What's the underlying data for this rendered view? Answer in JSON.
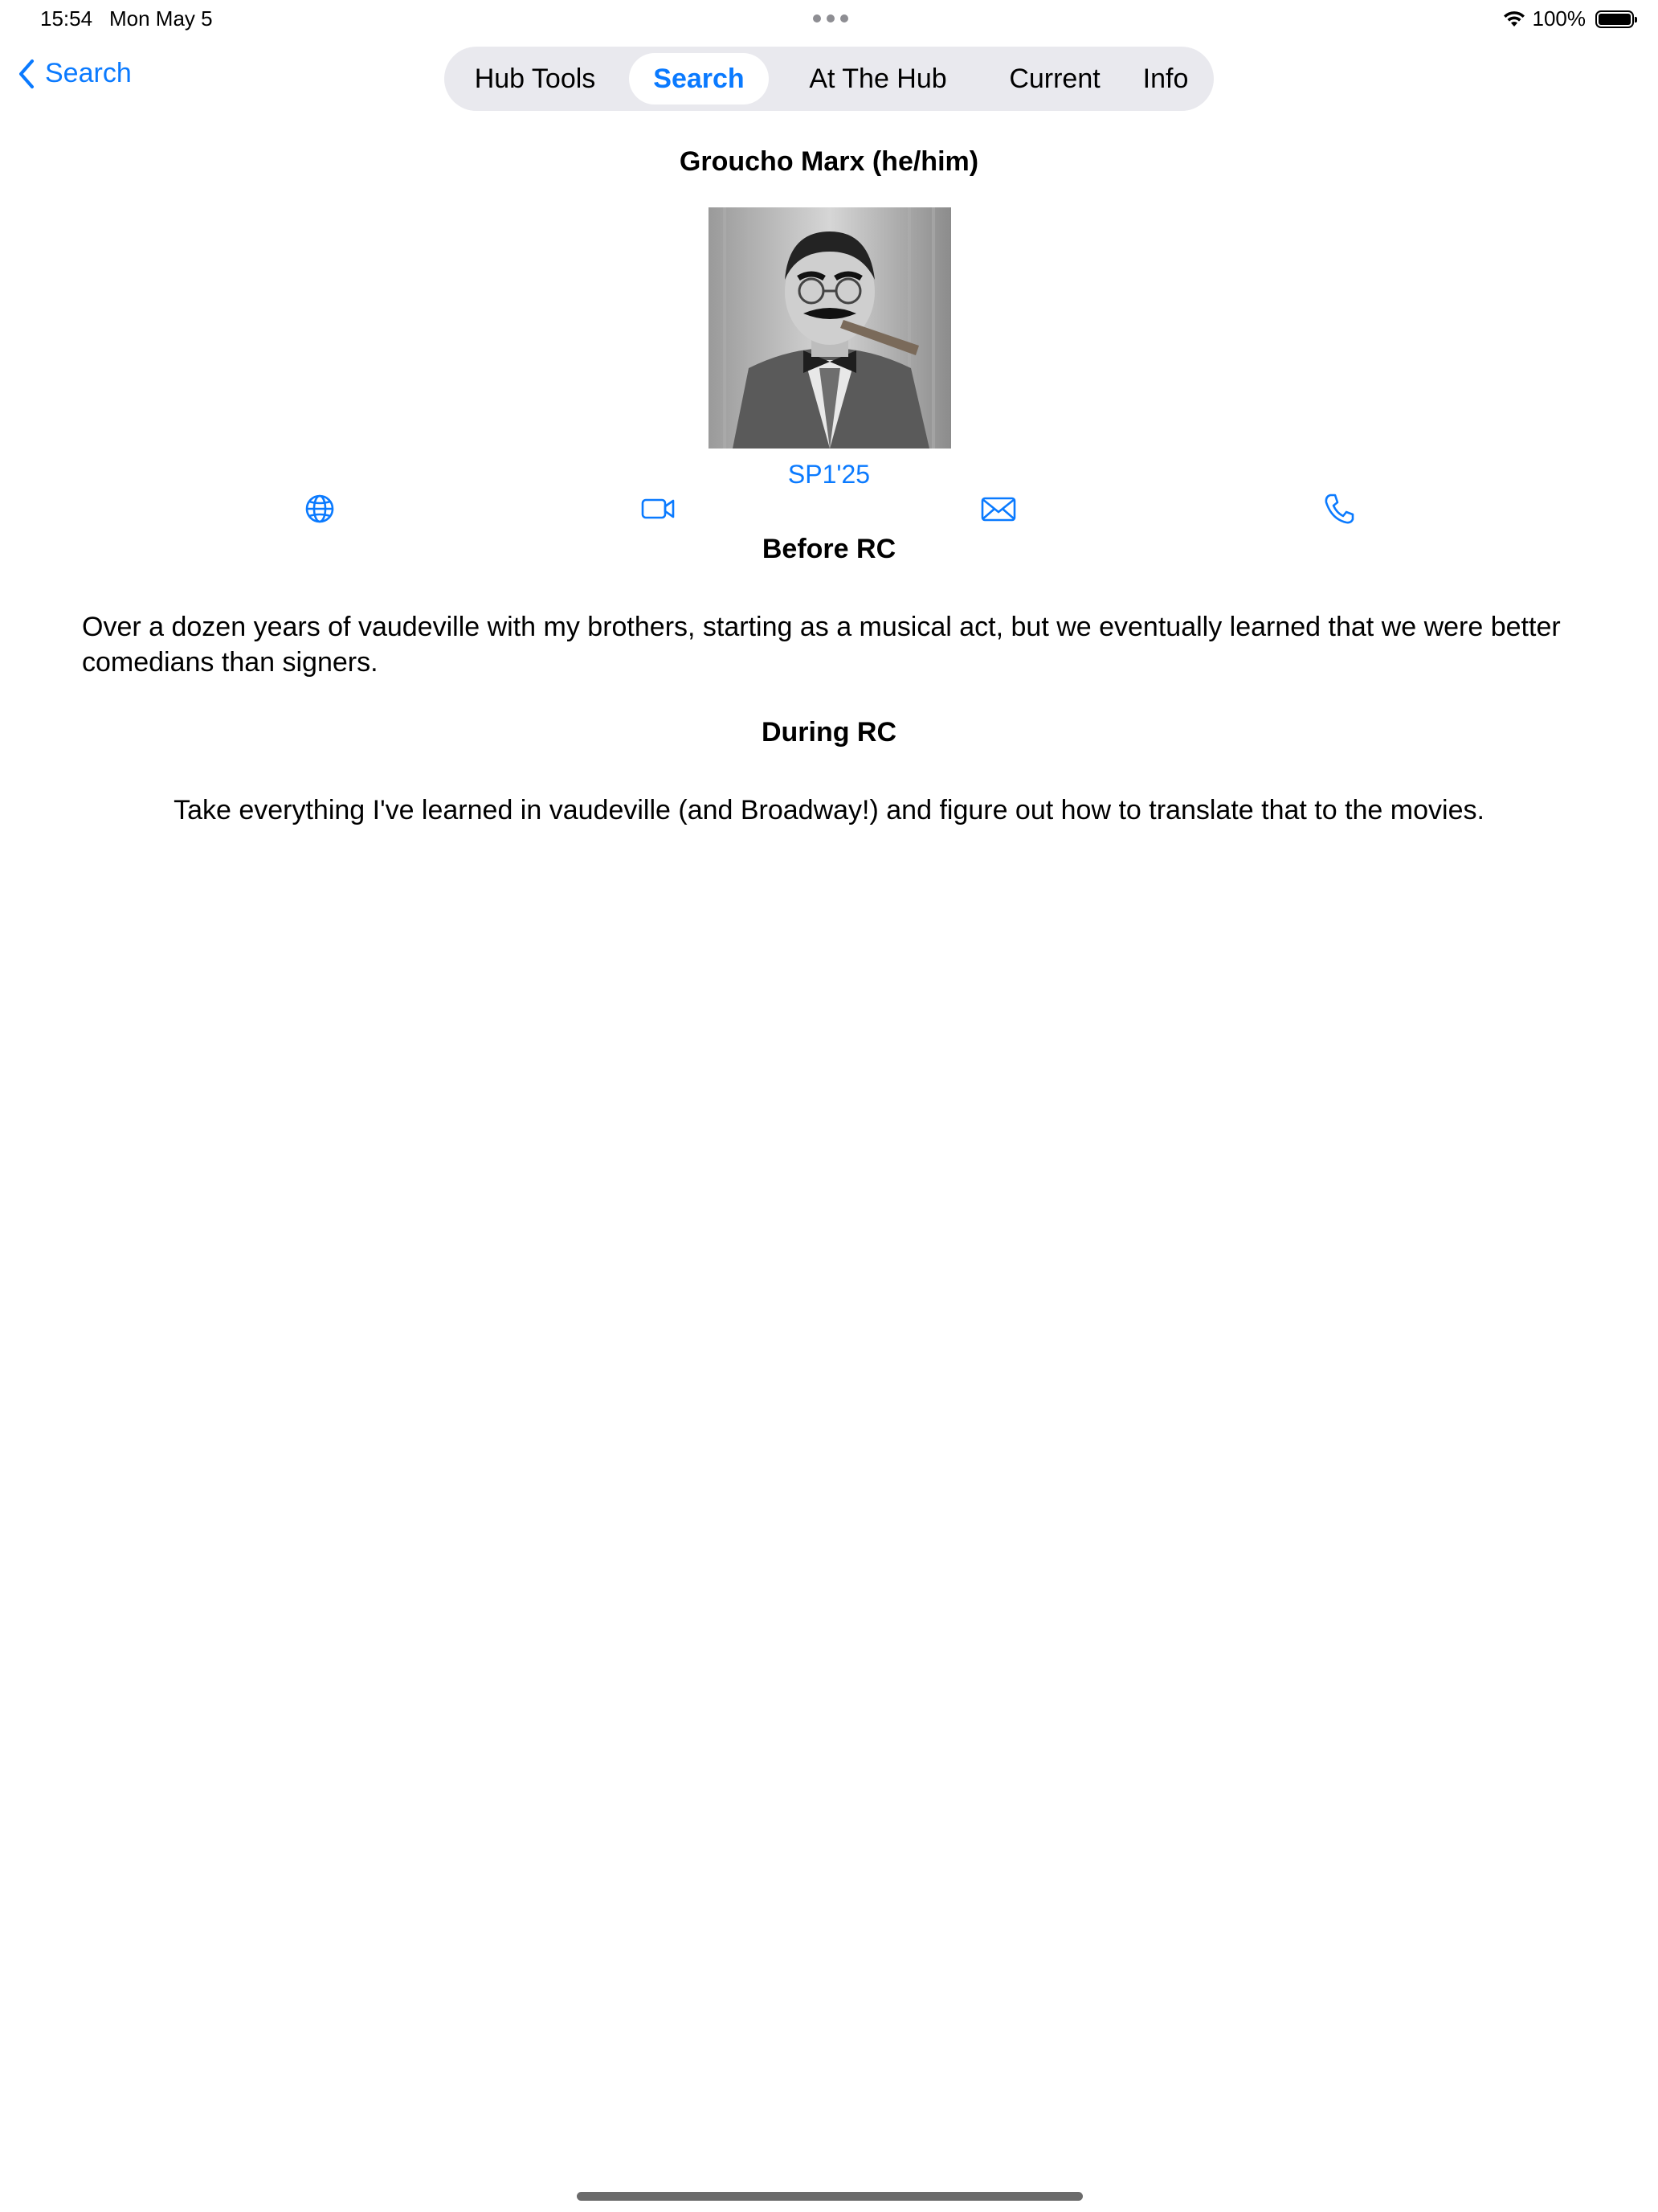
{
  "status_bar": {
    "time": "15:54",
    "date": "Mon May 5",
    "battery_text": "100%",
    "battery_level": 1.0,
    "wifi_icon": "wifi-icon",
    "battery_icon": "battery-icon"
  },
  "nav": {
    "back_label": "Search",
    "back_icon": "chevron-left-icon",
    "tabs": [
      {
        "label": "Hub Tools",
        "selected": false
      },
      {
        "label": "Search",
        "selected": true
      },
      {
        "label": "At The Hub",
        "selected": false
      },
      {
        "label": "Current",
        "selected": false
      },
      {
        "label": "Info",
        "selected": false
      }
    ]
  },
  "profile": {
    "name": "Groucho Marx (he/him)",
    "cohort": "SP1'25",
    "actions": [
      "globe-icon",
      "video-icon",
      "mail-icon",
      "phone-icon"
    ],
    "sections": [
      {
        "heading": "Before RC",
        "text": "Over a dozen years of vaudeville with my brothers, starting as a musical act, but we eventually learned that we were better comedians than signers."
      },
      {
        "heading": "During RC",
        "text": "Take everything I've learned in vaudeville (and Broadway!) and figure out how to translate that to the movies."
      }
    ]
  },
  "colors": {
    "accent": "#0a7aff",
    "tab_bar_bg": "#e9e9ee",
    "text": "#000000",
    "background": "#ffffff"
  }
}
